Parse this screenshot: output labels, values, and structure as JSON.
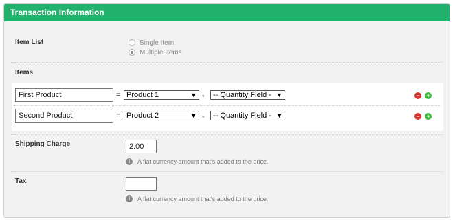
{
  "panel": {
    "title": "Transaction Information"
  },
  "item_list": {
    "label": "Item List",
    "options": [
      "Single Item",
      "Multiple Items"
    ],
    "selected": "Multiple Items"
  },
  "items": {
    "label": "Items",
    "rows": [
      {
        "name": "First Product",
        "equals": "=",
        "product": "Product 1",
        "multiply": "*",
        "quantity": "-- Quantity Field -"
      },
      {
        "name": "Second Product",
        "equals": "=",
        "product": "Product 2",
        "multiply": "*",
        "quantity": "-- Quantity Field -"
      }
    ]
  },
  "shipping": {
    "label": "Shipping Charge",
    "value": "2.00",
    "help": "A flat currency amount that's added to the price."
  },
  "tax": {
    "label": "Tax",
    "value": "",
    "help": "A flat currency amount that's added to the price."
  },
  "icons": {
    "info": "info-icon",
    "remove": "minus-circle-icon",
    "add": "plus-circle-icon",
    "dropdown": "chevron-down-icon"
  },
  "colors": {
    "header": "#23b26d",
    "remove": "#d9302c",
    "add": "#3dbb3d"
  }
}
